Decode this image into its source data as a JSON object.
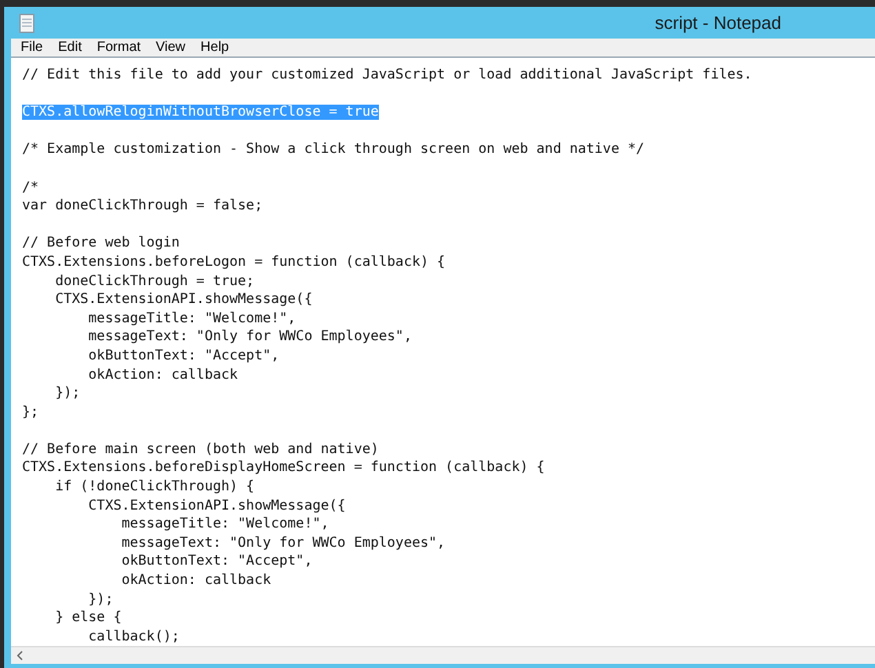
{
  "window": {
    "title": "script - Notepad"
  },
  "menu": [
    "File",
    "Edit",
    "Format",
    "View",
    "Help"
  ],
  "editor": {
    "lines": [
      {
        "kind": "code",
        "text": "// Edit this file to add your customized JavaScript or load additional JavaScript files."
      },
      {
        "kind": "blank"
      },
      {
        "kind": "selection",
        "text": "CTXS.allowReloginWithoutBrowserClose = true"
      },
      {
        "kind": "blank"
      },
      {
        "kind": "code",
        "text": "/* Example customization - Show a click through screen on web and native */"
      },
      {
        "kind": "blank"
      },
      {
        "kind": "code",
        "text": "/*"
      },
      {
        "kind": "code",
        "text": "var doneClickThrough = false;"
      },
      {
        "kind": "blank"
      },
      {
        "kind": "code",
        "text": "// Before web login"
      },
      {
        "kind": "code",
        "text": "CTXS.Extensions.beforeLogon = function (callback) {"
      },
      {
        "kind": "code",
        "text": "    doneClickThrough = true;"
      },
      {
        "kind": "code",
        "text": "    CTXS.ExtensionAPI.showMessage({"
      },
      {
        "kind": "code",
        "text": "        messageTitle: \"Welcome!\","
      },
      {
        "kind": "code",
        "text": "        messageText: \"Only for WWCo Employees\","
      },
      {
        "kind": "code",
        "text": "        okButtonText: \"Accept\","
      },
      {
        "kind": "code",
        "text": "        okAction: callback"
      },
      {
        "kind": "code",
        "text": "    });"
      },
      {
        "kind": "code",
        "text": "};"
      },
      {
        "kind": "blank"
      },
      {
        "kind": "code",
        "text": "// Before main screen (both web and native)"
      },
      {
        "kind": "code",
        "text": "CTXS.Extensions.beforeDisplayHomeScreen = function (callback) {"
      },
      {
        "kind": "code",
        "text": "    if (!doneClickThrough) {"
      },
      {
        "kind": "code",
        "text": "        CTXS.ExtensionAPI.showMessage({"
      },
      {
        "kind": "code",
        "text": "            messageTitle: \"Welcome!\","
      },
      {
        "kind": "code",
        "text": "            messageText: \"Only for WWCo Employees\","
      },
      {
        "kind": "code",
        "text": "            okButtonText: \"Accept\","
      },
      {
        "kind": "code",
        "text": "            okAction: callback"
      },
      {
        "kind": "code",
        "text": "        });"
      },
      {
        "kind": "code",
        "text": "    } else {"
      },
      {
        "kind": "code",
        "text": "        callback();"
      }
    ]
  }
}
